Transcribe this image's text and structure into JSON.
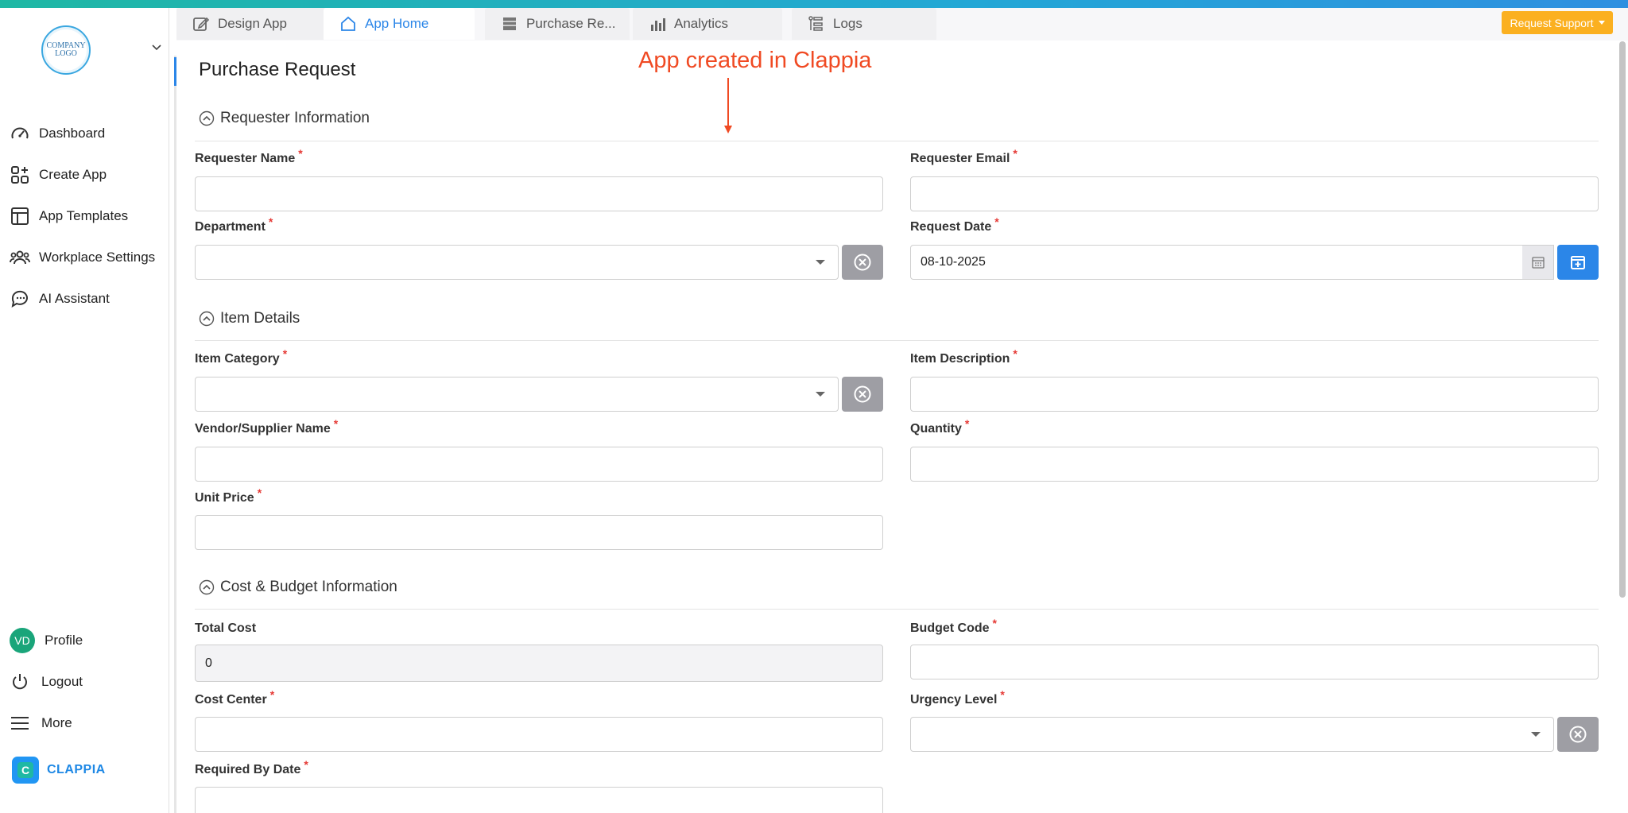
{
  "sidebar": {
    "logo_text": "COMPANY LOGO",
    "items": [
      {
        "label": "Dashboard",
        "icon": "speedometer-icon"
      },
      {
        "label": "Create App",
        "icon": "create-app-icon"
      },
      {
        "label": "App Templates",
        "icon": "templates-icon"
      },
      {
        "label": "Workplace Settings",
        "icon": "users-icon"
      },
      {
        "label": "AI Assistant",
        "icon": "ai-chat-icon"
      }
    ],
    "profile_initials": "VD",
    "profile_label": "Profile",
    "logout_label": "Logout",
    "more_label": "More",
    "brand_name": "CLAPPIA",
    "brand_mark": "C"
  },
  "tabs": [
    {
      "label": "Design App",
      "icon": "edit-icon",
      "active": false
    },
    {
      "label": "App Home",
      "icon": "home-icon",
      "active": true
    },
    {
      "label": "Purchase Re...",
      "icon": "table-icon",
      "active": false
    },
    {
      "label": "Analytics",
      "icon": "bar-chart-icon",
      "active": false
    },
    {
      "label": "Logs",
      "icon": "logs-icon",
      "active": false
    }
  ],
  "header": {
    "support_label": "Request Support"
  },
  "page": {
    "title": "Purchase Request",
    "annotation": "App created in Clappia"
  },
  "sections": {
    "requester": {
      "title": "Requester Information",
      "fields": {
        "requester_name": {
          "label": "Requester Name",
          "value": ""
        },
        "requester_email": {
          "label": "Requester Email",
          "value": ""
        },
        "department": {
          "label": "Department",
          "value": ""
        },
        "request_date": {
          "label": "Request Date",
          "value": "08-10-2025"
        }
      }
    },
    "items": {
      "title": "Item Details",
      "fields": {
        "item_category": {
          "label": "Item Category",
          "value": ""
        },
        "item_description": {
          "label": "Item Description",
          "value": ""
        },
        "vendor_name": {
          "label": "Vendor/Supplier Name",
          "value": ""
        },
        "quantity": {
          "label": "Quantity",
          "value": ""
        },
        "unit_price": {
          "label": "Unit Price",
          "value": ""
        }
      }
    },
    "cost": {
      "title": "Cost & Budget Information",
      "fields": {
        "total_cost": {
          "label": "Total Cost",
          "value": "0"
        },
        "budget_code": {
          "label": "Budget Code",
          "value": ""
        },
        "cost_center": {
          "label": "Cost Center",
          "value": ""
        },
        "urgency_level": {
          "label": "Urgency Level",
          "value": ""
        },
        "required_by_date": {
          "label": "Required By Date",
          "value": ""
        }
      }
    }
  },
  "required_mark": "*",
  "colors": {
    "accent": "#2b86e8",
    "annotation": "#f04a23",
    "support": "#fbb020",
    "required": "#e53935"
  }
}
